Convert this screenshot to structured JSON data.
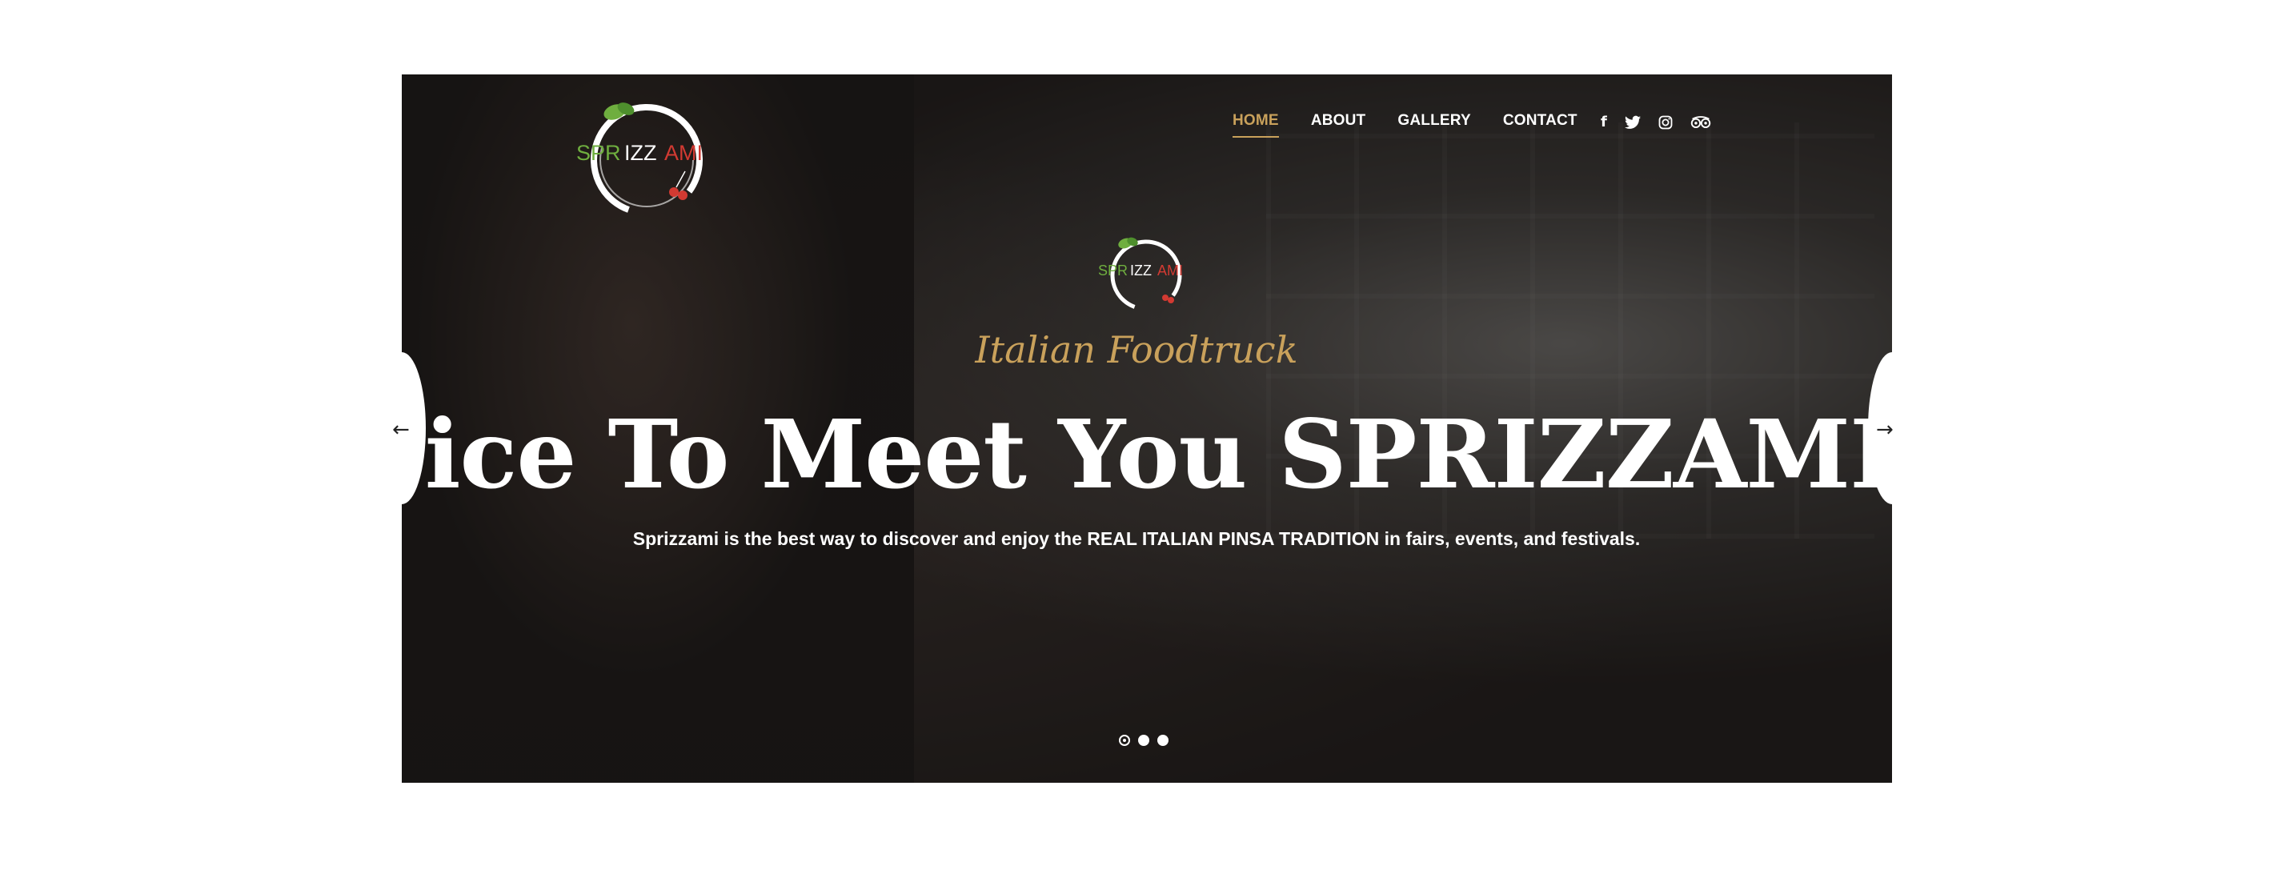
{
  "brand": {
    "name": "SPRIZZAMI",
    "tagline": "Italian Foodtruck"
  },
  "nav": {
    "items": [
      {
        "label": "HOME",
        "active": true
      },
      {
        "label": "ABOUT",
        "active": false
      },
      {
        "label": "GALLERY",
        "active": false
      },
      {
        "label": "CONTACT",
        "active": false
      }
    ]
  },
  "social": {
    "icons": [
      "facebook-icon",
      "twitter-icon",
      "instagram-icon",
      "tripadvisor-icon"
    ],
    "glyphs": [
      "f",
      "🐦",
      "◎",
      "∞"
    ]
  },
  "hero": {
    "subtitle": "Italian Foodtruck",
    "headline": "Nice To Meet You SPRIZZAMI!",
    "description": "Sprizzami is the best way to discover and enjoy the REAL ITALIAN PINSA TRADITION in fairs, events, and festivals.",
    "slides_total": 3,
    "active_slide": 1
  },
  "controls": {
    "prev_arrow": "←",
    "next_arrow": "→"
  },
  "colors": {
    "accent": "#c9a15b",
    "logo_green": "#6fae3f",
    "logo_red": "#d23a32",
    "text": "#ffffff",
    "background": "#ffffff"
  }
}
